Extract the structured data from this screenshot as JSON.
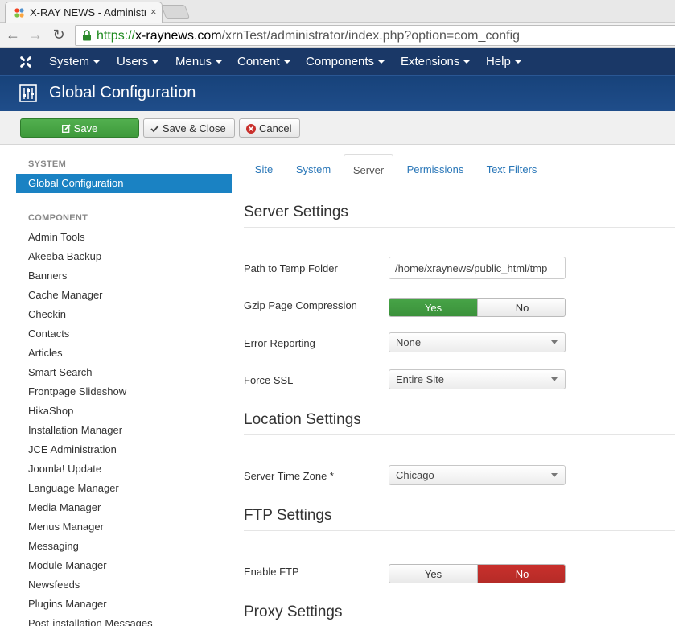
{
  "browser": {
    "tab_title": "X-RAY NEWS - Administra",
    "tab_close": "×",
    "url_scheme": "https://",
    "url_host": "x-raynews.com",
    "url_path": "/xrnTest/administrator/index.php?option=com_config",
    "icons": {
      "back": "←",
      "forward": "→",
      "reload": "↻"
    }
  },
  "topnav": {
    "items": [
      {
        "label": "System"
      },
      {
        "label": "Users"
      },
      {
        "label": "Menus"
      },
      {
        "label": "Content"
      },
      {
        "label": "Components"
      },
      {
        "label": "Extensions"
      },
      {
        "label": "Help"
      }
    ]
  },
  "header": {
    "title": "Global Configuration"
  },
  "toolbar": {
    "save_label": "Save",
    "save_close_label": "Save & Close",
    "cancel_label": "Cancel",
    "save_color": "#46a546",
    "cancel_icon_color": "#c9302c"
  },
  "sidebar": {
    "system_heading": "SYSTEM",
    "active_item": "Global Configuration",
    "component_heading": "COMPONENT",
    "items": [
      "Admin Tools",
      "Akeeba Backup",
      "Banners",
      "Cache Manager",
      "Checkin",
      "Contacts",
      "Articles",
      "Smart Search",
      "Frontpage Slideshow",
      "HikaShop",
      "Installation Manager",
      "JCE Administration",
      "Joomla! Update",
      "Language Manager",
      "Media Manager",
      "Menus Manager",
      "Messaging",
      "Module Manager",
      "Newsfeeds",
      "Plugins Manager",
      "Post-installation Messages"
    ]
  },
  "tabs": {
    "site": "Site",
    "system": "System",
    "server": "Server",
    "permissions": "Permissions",
    "text_filters": "Text Filters",
    "active": "Server"
  },
  "server_settings": {
    "title": "Server Settings",
    "temp_path_label": "Path to Temp Folder",
    "temp_path_value": "/home/xraynews/public_html/tmp",
    "gzip_label": "Gzip Page Compression",
    "gzip_yes": "Yes",
    "gzip_no": "No",
    "gzip_selected": "Yes",
    "error_reporting_label": "Error Reporting",
    "error_reporting_value": "None",
    "force_ssl_label": "Force SSL",
    "force_ssl_value": "Entire Site"
  },
  "location_settings": {
    "title": "Location Settings",
    "timezone_label": "Server Time Zone *",
    "timezone_value": "Chicago"
  },
  "ftp_settings": {
    "title": "FTP Settings",
    "enable_label": "Enable FTP",
    "enable_yes": "Yes",
    "enable_no": "No",
    "enable_selected": "No"
  },
  "proxy_settings": {
    "title": "Proxy Settings"
  },
  "colors": {
    "nav_bg": "#1a3867",
    "active_blue": "#1a82c3",
    "link_blue": "#2a77b8",
    "toggle_green": "#46a546",
    "toggle_red": "#c9302c"
  }
}
